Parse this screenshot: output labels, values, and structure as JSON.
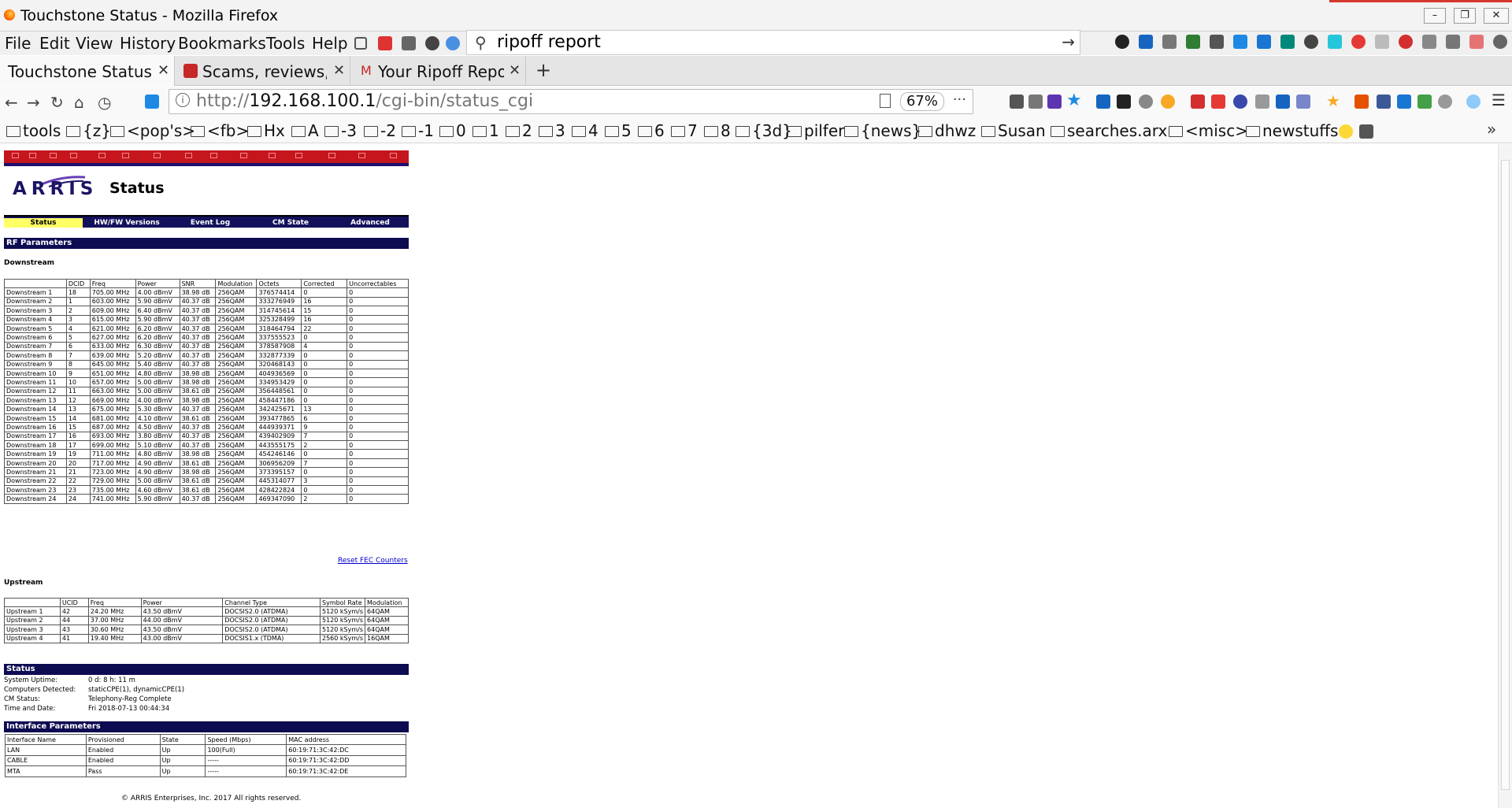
{
  "window": {
    "title": "Touchstone Status - Mozilla Firefox"
  },
  "menubar": {
    "items": [
      "File",
      "Edit",
      "View",
      "History",
      "Bookmarks",
      "Tools",
      "Help"
    ]
  },
  "search_bar": {
    "value": "ripoff report"
  },
  "tabs": [
    {
      "label": "Touchstone Status"
    },
    {
      "label": "Scams, reviews, c"
    },
    {
      "label": "Your Ripoff Repor"
    }
  ],
  "navbar": {
    "url_prefix": "http://",
    "url_host": "192.168.100.1",
    "url_path": "/cgi-bin/status_cgi",
    "zoom": "67%"
  },
  "bookmarks": [
    "tools",
    "{z}",
    "<pop's>",
    "<fb>",
    "Hx",
    "A",
    "-3",
    "-2",
    "-1",
    "0",
    "1",
    "2",
    "3",
    "4",
    "5",
    "6",
    "7",
    "8",
    "{3d}",
    "pilfer",
    "{news}",
    "dhwz",
    "Susan",
    "searches.arx",
    "<misc>",
    "newstuffs"
  ],
  "page": {
    "brand": "ARRIS",
    "title": "Status",
    "nav": [
      "Status",
      "HW/FW Versions",
      "Event Log",
      "CM State",
      "Advanced"
    ],
    "rf_heading": "RF Parameters",
    "downstream_heading": "Downstream",
    "downstream_headers": [
      "",
      "DCID",
      "Freq",
      "Power",
      "SNR",
      "Modulation",
      "Octets",
      "Corrected",
      "Uncorrectables"
    ],
    "downstream_rows": [
      [
        "Downstream 1",
        "18",
        "705.00 MHz",
        "4.00 dBmV",
        "38.98 dB",
        "256QAM",
        "376574414",
        "0",
        "0"
      ],
      [
        "Downstream 2",
        "1",
        "603.00 MHz",
        "5.90 dBmV",
        "40.37 dB",
        "256QAM",
        "333276949",
        "16",
        "0"
      ],
      [
        "Downstream 3",
        "2",
        "609.00 MHz",
        "6.40 dBmV",
        "40.37 dB",
        "256QAM",
        "314745614",
        "15",
        "0"
      ],
      [
        "Downstream 4",
        "3",
        "615.00 MHz",
        "5.90 dBmV",
        "40.37 dB",
        "256QAM",
        "325328499",
        "16",
        "0"
      ],
      [
        "Downstream 5",
        "4",
        "621.00 MHz",
        "6.20 dBmV",
        "40.37 dB",
        "256QAM",
        "318464794",
        "22",
        "0"
      ],
      [
        "Downstream 6",
        "5",
        "627.00 MHz",
        "6.20 dBmV",
        "40.37 dB",
        "256QAM",
        "337555523",
        "0",
        "0"
      ],
      [
        "Downstream 7",
        "6",
        "633.00 MHz",
        "6.30 dBmV",
        "40.37 dB",
        "256QAM",
        "378587908",
        "4",
        "0"
      ],
      [
        "Downstream 8",
        "7",
        "639.00 MHz",
        "5.20 dBmV",
        "40.37 dB",
        "256QAM",
        "332877339",
        "0",
        "0"
      ],
      [
        "Downstream 9",
        "8",
        "645.00 MHz",
        "5.40 dBmV",
        "40.37 dB",
        "256QAM",
        "320468143",
        "0",
        "0"
      ],
      [
        "Downstream 10",
        "9",
        "651.00 MHz",
        "4.80 dBmV",
        "38.98 dB",
        "256QAM",
        "404936569",
        "0",
        "0"
      ],
      [
        "Downstream 11",
        "10",
        "657.00 MHz",
        "5.00 dBmV",
        "38.98 dB",
        "256QAM",
        "334953429",
        "0",
        "0"
      ],
      [
        "Downstream 12",
        "11",
        "663.00 MHz",
        "5.00 dBmV",
        "38.61 dB",
        "256QAM",
        "356448561",
        "0",
        "0"
      ],
      [
        "Downstream 13",
        "12",
        "669.00 MHz",
        "4.00 dBmV",
        "38.98 dB",
        "256QAM",
        "458447186",
        "0",
        "0"
      ],
      [
        "Downstream 14",
        "13",
        "675.00 MHz",
        "5.30 dBmV",
        "40.37 dB",
        "256QAM",
        "342425671",
        "13",
        "0"
      ],
      [
        "Downstream 15",
        "14",
        "681.00 MHz",
        "4.10 dBmV",
        "38.61 dB",
        "256QAM",
        "393477865",
        "6",
        "0"
      ],
      [
        "Downstream 16",
        "15",
        "687.00 MHz",
        "4.50 dBmV",
        "40.37 dB",
        "256QAM",
        "444939371",
        "9",
        "0"
      ],
      [
        "Downstream 17",
        "16",
        "693.00 MHz",
        "3.80 dBmV",
        "40.37 dB",
        "256QAM",
        "439402909",
        "7",
        "0"
      ],
      [
        "Downstream 18",
        "17",
        "699.00 MHz",
        "5.10 dBmV",
        "40.37 dB",
        "256QAM",
        "443555175",
        "2",
        "0"
      ],
      [
        "Downstream 19",
        "19",
        "711.00 MHz",
        "4.80 dBmV",
        "38.98 dB",
        "256QAM",
        "454246146",
        "0",
        "0"
      ],
      [
        "Downstream 20",
        "20",
        "717.00 MHz",
        "4.90 dBmV",
        "38.61 dB",
        "256QAM",
        "306956209",
        "7",
        "0"
      ],
      [
        "Downstream 21",
        "21",
        "723.00 MHz",
        "4.90 dBmV",
        "38.98 dB",
        "256QAM",
        "373395157",
        "0",
        "0"
      ],
      [
        "Downstream 22",
        "22",
        "729.00 MHz",
        "5.00 dBmV",
        "38.61 dB",
        "256QAM",
        "445314077",
        "3",
        "0"
      ],
      [
        "Downstream 23",
        "23",
        "735.00 MHz",
        "4.60 dBmV",
        "38.61 dB",
        "256QAM",
        "428422824",
        "0",
        "0"
      ],
      [
        "Downstream 24",
        "24",
        "741.00 MHz",
        "5.90 dBmV",
        "40.37 dB",
        "256QAM",
        "469347090",
        "2",
        "0"
      ]
    ],
    "reset_link": "Reset FEC Counters",
    "upstream_heading": "Upstream",
    "upstream_headers": [
      "",
      "UCID",
      "Freq",
      "Power",
      "Channel Type",
      "Symbol Rate",
      "Modulation"
    ],
    "upstream_rows": [
      [
        "Upstream 1",
        "42",
        "24.20 MHz",
        "43.50 dBmV",
        "DOCSIS2.0 (ATDMA)",
        "5120 kSym/s",
        "64QAM"
      ],
      [
        "Upstream 2",
        "44",
        "37.00 MHz",
        "44.00 dBmV",
        "DOCSIS2.0 (ATDMA)",
        "5120 kSym/s",
        "64QAM"
      ],
      [
        "Upstream 3",
        "43",
        "30.60 MHz",
        "43.50 dBmV",
        "DOCSIS2.0 (ATDMA)",
        "5120 kSym/s",
        "64QAM"
      ],
      [
        "Upstream 4",
        "41",
        "19.40 MHz",
        "43.00 dBmV",
        "DOCSIS1.x (TDMA)",
        "2560 kSym/s",
        "16QAM"
      ]
    ],
    "status_heading": "Status",
    "status_items": [
      {
        "label": "System Uptime:",
        "value": "0 d:  8 h: 11  m"
      },
      {
        "label": "Computers Detected:",
        "value": "staticCPE(1), dynamicCPE(1)"
      },
      {
        "label": "CM Status:",
        "value": "Telephony-Reg Complete"
      },
      {
        "label": "Time and Date:",
        "value": "Fri 2018-07-13 00:44:34"
      }
    ],
    "iface_heading": "Interface Parameters",
    "iface_headers": [
      "Interface Name",
      "Provisioned",
      "State",
      "Speed (Mbps)",
      "MAC address"
    ],
    "iface_rows": [
      [
        "LAN",
        "Enabled",
        "Up",
        "100(Full)",
        "60:19:71:3C:42:DC"
      ],
      [
        "CABLE",
        "Enabled",
        "Up",
        "-----",
        "60:19:71:3C:42:DD"
      ],
      [
        "MTA",
        "Pass",
        "Up",
        "-----",
        "60:19:71:3C:42:DE"
      ]
    ],
    "footer": "© ARRIS Enterprises, Inc. 2017 All rights reserved."
  }
}
